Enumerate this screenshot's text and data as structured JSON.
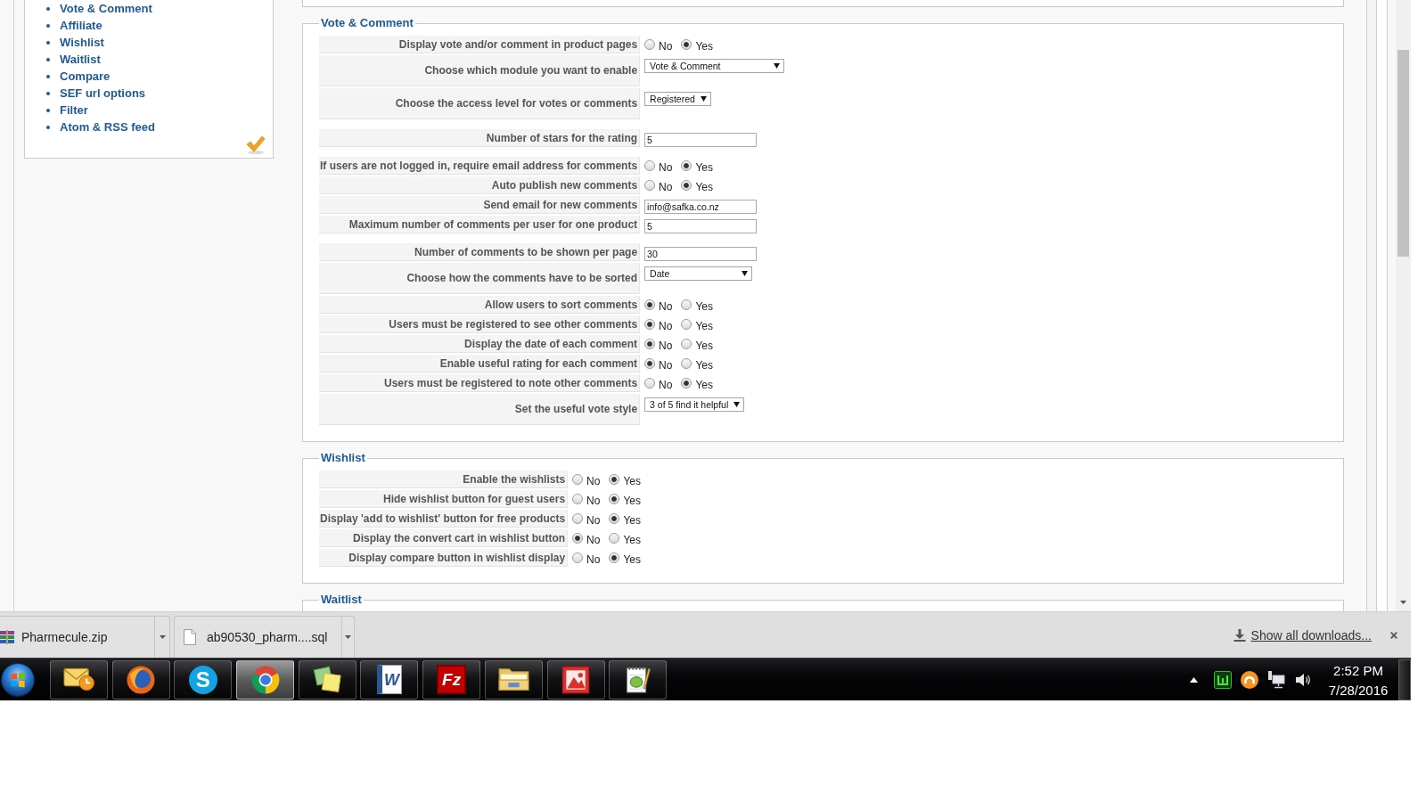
{
  "sidebar": {
    "items": [
      "Vote & Comment",
      "Affiliate",
      "Wishlist",
      "Waitlist",
      "Compare",
      "SEF url options",
      "Filter",
      "Atom & RSS feed"
    ]
  },
  "fieldsets": [
    {
      "legend": "Vote & Comment",
      "groups": [
        {
          "rows": [
            {
              "label": "Display vote and/or comment in product pages",
              "kind": "radio",
              "options": [
                {
                  "label": "No",
                  "selected": false
                },
                {
                  "label": "Yes",
                  "selected": true
                }
              ]
            },
            {
              "label": "Choose which module you want to enable",
              "kind": "select",
              "value": "Vote & Comment"
            },
            {
              "label": "Choose the access level for votes or comments",
              "kind": "select",
              "value": "Registered"
            }
          ]
        },
        {
          "rows": [
            {
              "label": "Number of stars for the rating",
              "kind": "text",
              "value": "5"
            }
          ]
        },
        {
          "rows": [
            {
              "label": "If users are not logged in, require email address for comments",
              "kind": "radio",
              "options": [
                {
                  "label": "No",
                  "selected": false
                },
                {
                  "label": "Yes",
                  "selected": true
                }
              ]
            },
            {
              "label": "Auto publish new comments",
              "kind": "radio",
              "options": [
                {
                  "label": "No",
                  "selected": false
                },
                {
                  "label": "Yes",
                  "selected": true
                }
              ]
            },
            {
              "label": "Send email for new comments",
              "kind": "text",
              "value": "info@safka.co.nz"
            },
            {
              "label": "Maximum number of comments per user for one product",
              "kind": "text",
              "value": "5"
            }
          ]
        },
        {
          "rows": [
            {
              "label": "Number of comments to be shown per page",
              "kind": "text",
              "value": "30"
            },
            {
              "label": "Choose how the comments have to be sorted",
              "kind": "select",
              "value": "Date"
            },
            {
              "label": "Allow users to sort comments",
              "kind": "radio",
              "options": [
                {
                  "label": "No",
                  "selected": true
                },
                {
                  "label": "Yes",
                  "selected": false
                }
              ]
            },
            {
              "label": "Users must be registered to see other comments",
              "kind": "radio",
              "options": [
                {
                  "label": "No",
                  "selected": true
                },
                {
                  "label": "Yes",
                  "selected": false
                }
              ]
            },
            {
              "label": "Display the date of each comment",
              "kind": "radio",
              "options": [
                {
                  "label": "No",
                  "selected": true
                },
                {
                  "label": "Yes",
                  "selected": false
                }
              ]
            },
            {
              "label": "Enable useful rating for each comment",
              "kind": "radio",
              "options": [
                {
                  "label": "No",
                  "selected": true
                },
                {
                  "label": "Yes",
                  "selected": false
                }
              ]
            },
            {
              "label": "Users must be registered to note other comments",
              "kind": "radio",
              "options": [
                {
                  "label": "No",
                  "selected": false
                },
                {
                  "label": "Yes",
                  "selected": true
                }
              ]
            },
            {
              "label": "Set the useful vote style",
              "kind": "select",
              "value": "3 of 5 find it helpful"
            }
          ]
        }
      ]
    },
    {
      "legend": "Wishlist",
      "groups": [
        {
          "rows": [
            {
              "label": "Enable the wishlists",
              "kind": "radio",
              "options": [
                {
                  "label": "No",
                  "selected": false
                },
                {
                  "label": "Yes",
                  "selected": true
                }
              ]
            },
            {
              "label": "Hide wishlist button for guest users",
              "kind": "radio",
              "options": [
                {
                  "label": "No",
                  "selected": false
                },
                {
                  "label": "Yes",
                  "selected": true
                }
              ]
            },
            {
              "label": "Display 'add to wishlist' button for free products",
              "kind": "radio",
              "options": [
                {
                  "label": "No",
                  "selected": false
                },
                {
                  "label": "Yes",
                  "selected": true
                }
              ]
            },
            {
              "label": "Display the convert cart in wishlist button",
              "kind": "radio",
              "options": [
                {
                  "label": "No",
                  "selected": true
                },
                {
                  "label": "Yes",
                  "selected": false
                }
              ]
            },
            {
              "label": "Display compare button in wishlist display",
              "kind": "radio",
              "options": [
                {
                  "label": "No",
                  "selected": false
                },
                {
                  "label": "Yes",
                  "selected": true
                }
              ]
            }
          ]
        }
      ]
    },
    {
      "legend": "Waitlist"
    }
  ],
  "downloads_bar": {
    "items": [
      {
        "kind": "archive",
        "name": "Pharmecule.zip"
      },
      {
        "kind": "file",
        "name": "ab90530_pharm....sql"
      }
    ],
    "show_all": "Show all downloads..."
  },
  "taskbar": {
    "apps": [
      {
        "kind": "mail",
        "active": false
      },
      {
        "kind": "globe",
        "active": false
      },
      {
        "kind": "chat",
        "logo_text": "S",
        "active": false
      },
      {
        "kind": "wheel",
        "active": true
      },
      {
        "kind": "notes",
        "active": false
      },
      {
        "kind": "document",
        "logo_text": "W",
        "active": false
      },
      {
        "kind": "transfer",
        "logo_text": "Fz",
        "active": false
      },
      {
        "kind": "folder",
        "active": false
      },
      {
        "kind": "picture",
        "active": false
      },
      {
        "kind": "notepad",
        "active": false
      }
    ],
    "clock": {
      "time": "2:52 PM",
      "date": "7/28/2016"
    }
  }
}
